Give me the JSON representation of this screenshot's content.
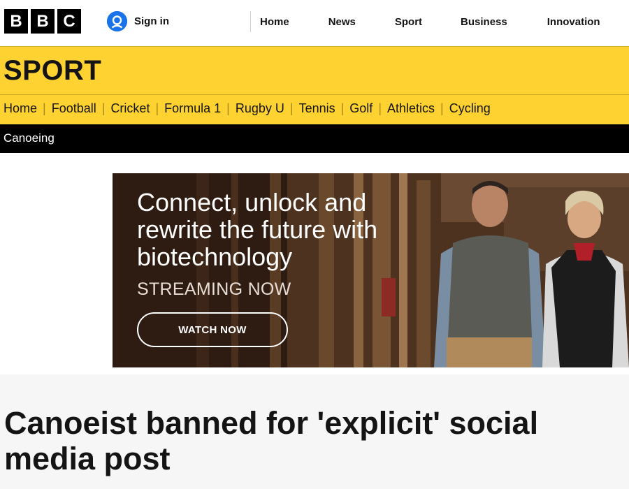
{
  "header": {
    "logo": [
      "B",
      "B",
      "C"
    ],
    "signin_label": "Sign in",
    "nav": [
      {
        "label": "Home"
      },
      {
        "label": "News"
      },
      {
        "label": "Sport"
      },
      {
        "label": "Business"
      },
      {
        "label": "Innovation"
      }
    ]
  },
  "sport": {
    "title": "SPORT",
    "nav": [
      {
        "label": "Home"
      },
      {
        "label": "Football"
      },
      {
        "label": "Cricket"
      },
      {
        "label": "Formula 1"
      },
      {
        "label": "Rugby U"
      },
      {
        "label": "Tennis"
      },
      {
        "label": "Golf"
      },
      {
        "label": "Athletics"
      },
      {
        "label": "Cycling"
      }
    ],
    "subnav_label": "Canoeing"
  },
  "ad": {
    "headline": "Connect, unlock and rewrite the future with biotechnology",
    "subtext": "STREAMING NOW",
    "button_label": "WATCH NOW"
  },
  "article": {
    "headline": "Canoeist banned for 'explicit' social media post"
  },
  "colors": {
    "sport_yellow": "#fed230",
    "signin_blue": "#1a73e8",
    "black": "#000000"
  }
}
